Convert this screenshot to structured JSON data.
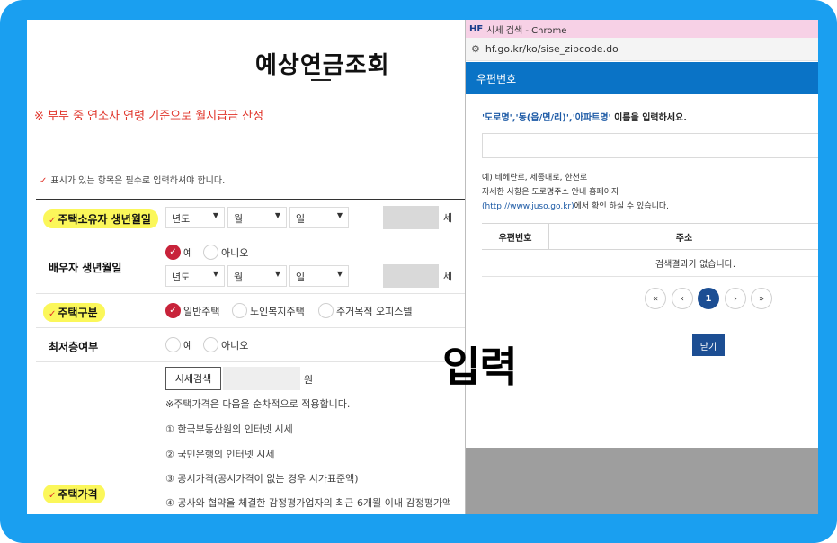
{
  "form": {
    "title": "예상연금조회",
    "notice": "※ 부부 중 연소자 연령 기준으로 월지급금 산정",
    "required_note": "표시가 있는 항목은 필수로 입력하셔야 합니다.",
    "owner_birth": {
      "label": "주택소유자 생년월일",
      "year": "년도",
      "month": "월",
      "day": "일",
      "unit": "세"
    },
    "spouse_birth": {
      "label": "배우자 생년월일",
      "yes": "예",
      "no": "아니오",
      "year": "년도",
      "month": "월",
      "day": "일",
      "unit": "세"
    },
    "house_type": {
      "label": "주택구분",
      "options": [
        "일반주택",
        "노인복지주택",
        "주거목적 오피스텔"
      ]
    },
    "top_floor": {
      "label": "최저층여부",
      "yes": "예",
      "no": "아니오"
    },
    "house_price": {
      "label": "주택가격",
      "search_button": "시세검색",
      "unit": "원",
      "notes": [
        "※주택가격은 다음을 순차적으로 적용합니다.",
        "① 한국부동산원의 인터넷 시세",
        "② 국민은행의 인터넷 시세",
        "③ 공시가격(공시가격이 없는 경우 시가표준액)",
        "④ 공사와 협약을 체결한 감정평가업자의 최근 6개월 이내 감정평가액"
      ]
    }
  },
  "popup": {
    "window_title": "시세 검색 - Chrome",
    "logo": "HF",
    "url": "hf.go.kr/ko/sise_zipcode.do",
    "header": "우편번호",
    "instruction_blue": "'도로명','동(읍/면/리)','아파트명'",
    "instruction_rest": " 이름을 입력하세요.",
    "example_lines": [
      "예) 테헤란로, 세종대로, 한천로",
      "자세한 사항은 도로명주소 안내 홈페이지"
    ],
    "link": "(http://www.juso.go.kr)",
    "link_suffix": "에서 확인 하실 수 있습니다.",
    "col_zip": "우편번호",
    "col_addr": "주소",
    "empty": "검색결과가 없습니다.",
    "pager": [
      "«",
      "‹",
      "1",
      "›",
      "»"
    ],
    "close": "닫기"
  },
  "overlay": "입력",
  "colors": {
    "frame": "#1a9ff0",
    "highlight": "#fbf75a",
    "accent_red": "#c8233a",
    "popup_header": "#0a73c6",
    "navy": "#1c4e93"
  }
}
